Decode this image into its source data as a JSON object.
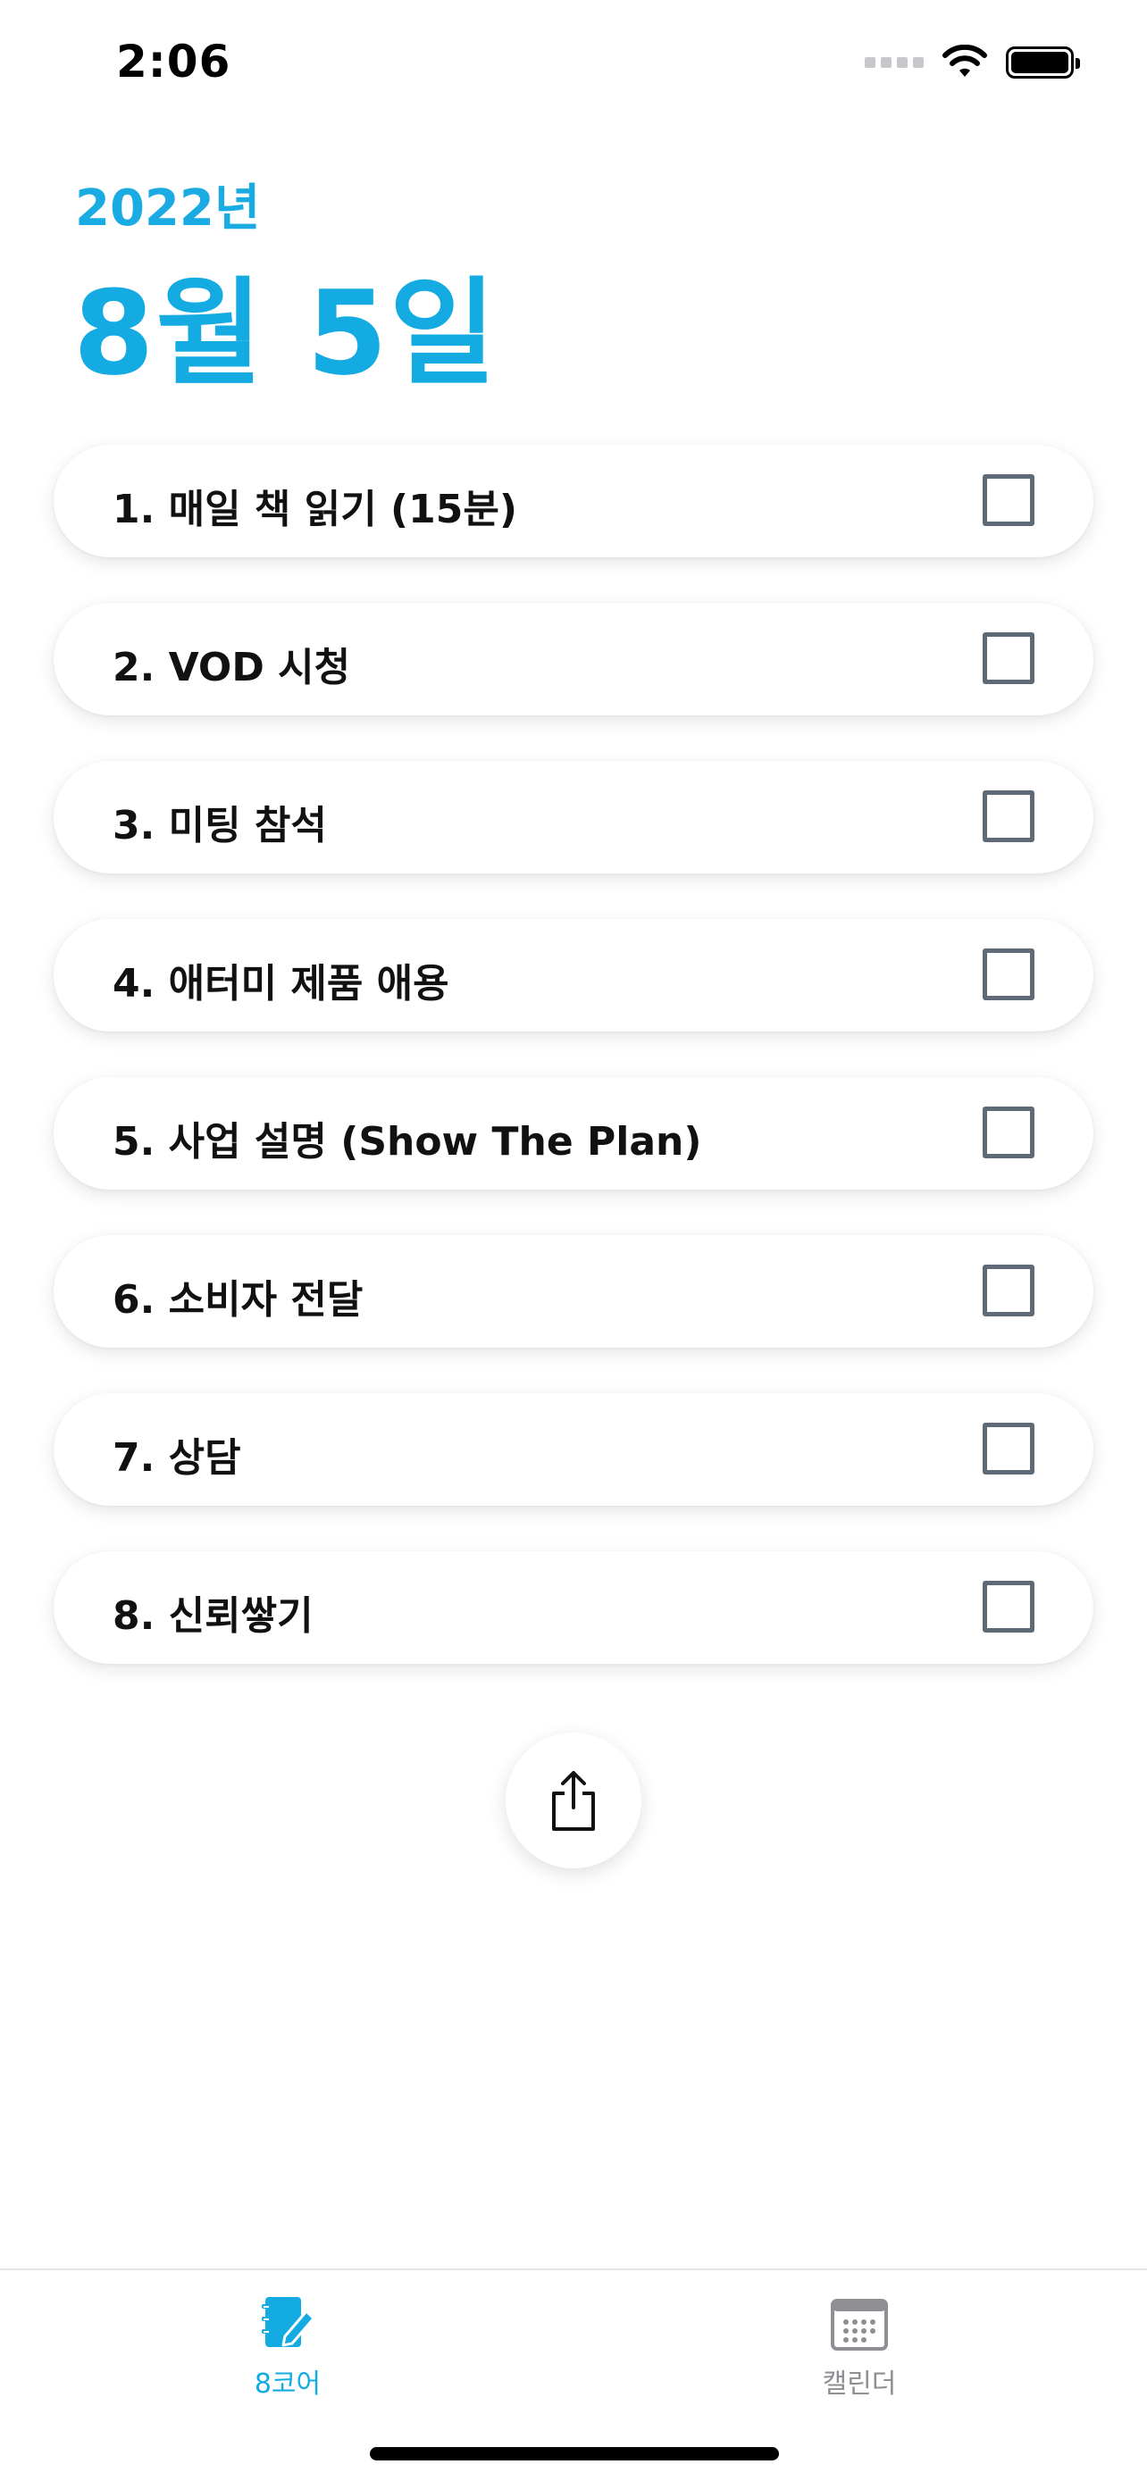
{
  "status_bar": {
    "time": "2:06"
  },
  "header": {
    "year": "2022년",
    "date": "8월 5일"
  },
  "tasks": [
    {
      "label": "1. 매일 책 읽기 (15분)",
      "checked": false
    },
    {
      "label": "2. VOD 시청",
      "checked": false
    },
    {
      "label": "3. 미팅 참석",
      "checked": false
    },
    {
      "label": "4. 애터미 제품 애용",
      "checked": false
    },
    {
      "label": "5. 사업 설명 (Show The Plan)",
      "checked": false
    },
    {
      "label": "6. 소비자 전달",
      "checked": false
    },
    {
      "label": "7. 상담",
      "checked": false
    },
    {
      "label": "8. 신뢰쌓기",
      "checked": false
    }
  ],
  "share": {
    "icon": "share-icon"
  },
  "tab_bar": {
    "tabs": [
      {
        "label": "8코어",
        "icon": "notebook-pen-icon",
        "active": true
      },
      {
        "label": "캘린더",
        "icon": "calendar-icon",
        "active": false
      }
    ]
  },
  "colors": {
    "accent": "#14abe2",
    "checkbox_border": "#5e6a75",
    "inactive_tab": "#8e8e93"
  }
}
